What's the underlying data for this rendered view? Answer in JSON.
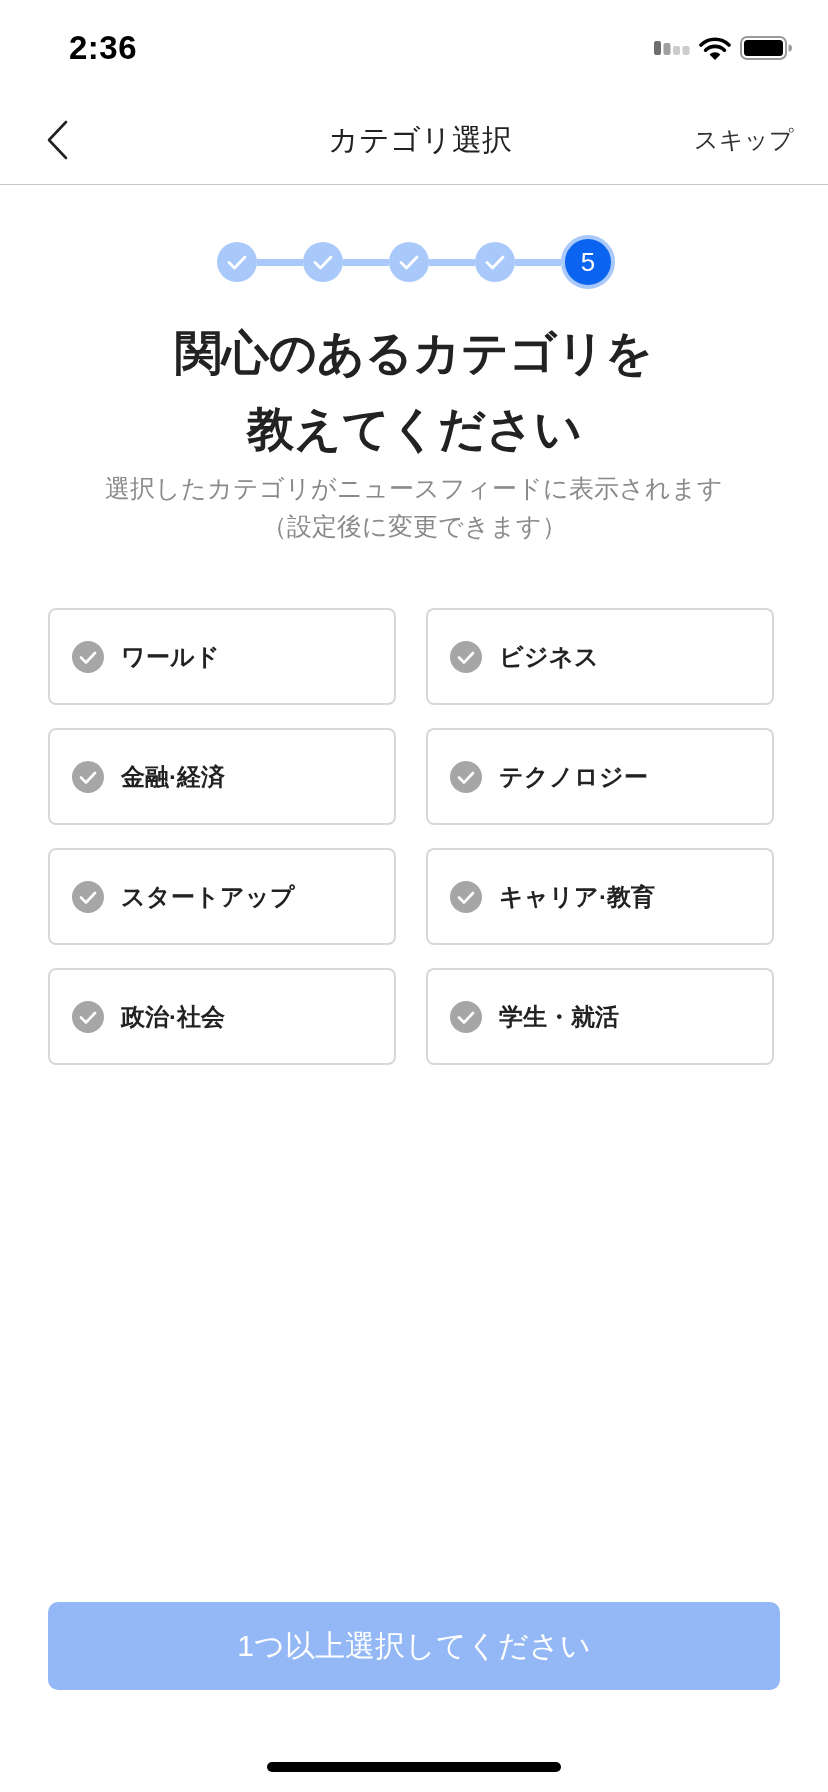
{
  "status_bar": {
    "time": "2:36"
  },
  "nav": {
    "title": "カテゴリ選択",
    "action": "スキップ"
  },
  "stepper": [
    {
      "completed": true,
      "selected": false
    },
    {
      "completed": true,
      "selected": false
    },
    {
      "completed": true,
      "selected": false
    },
    {
      "completed": true,
      "selected": false
    },
    {
      "label": "5",
      "completed": false,
      "selected": true
    }
  ],
  "heading": "関心のあるカテゴリを教えてください",
  "subtitle": "選択したカテゴリがニュースフィードに表示されます（設定後に変更できます）",
  "categories": [
    {
      "label": "ワールド",
      "selected": false
    },
    {
      "label": "ビジネス",
      "selected": false
    },
    {
      "label": "金融·経済",
      "selected": false
    },
    {
      "label": "テクノロジー",
      "selected": false
    },
    {
      "label": "スタートアップ",
      "selected": false
    },
    {
      "label": "キャリア·教育",
      "selected": false
    },
    {
      "label": "政治·社会",
      "selected": false
    },
    {
      "label": "学生・就活",
      "selected": false
    }
  ],
  "submit": {
    "label": "1つ以上選択してください",
    "disabled": true
  }
}
